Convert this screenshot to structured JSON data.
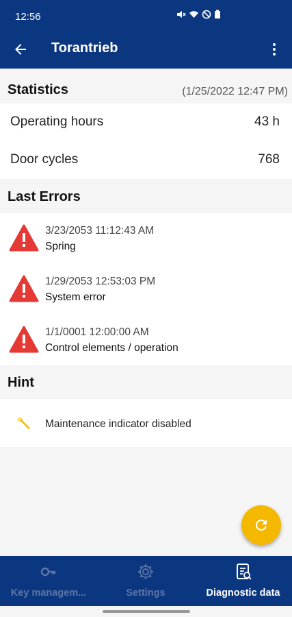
{
  "status_bar": {
    "time": "12:56"
  },
  "app_bar": {
    "title": "Torantrieb"
  },
  "statistics": {
    "title": "Statistics",
    "timestamp": "(1/25/2022 12:47 PM)",
    "rows": [
      {
        "label": "Operating hours",
        "value": "43 h"
      },
      {
        "label": "Door cycles",
        "value": "768"
      }
    ]
  },
  "last_errors": {
    "title": "Last Errors",
    "items": [
      {
        "date": "3/23/2053 11:12:43 AM",
        "description": "Spring"
      },
      {
        "date": "1/29/2053 12:53:03 PM",
        "description": "System error"
      },
      {
        "date": "1/1/0001 12:00:00 AM",
        "description": "Control elements / operation"
      }
    ]
  },
  "hint": {
    "title": "Hint",
    "text": "Maintenance indicator disabled"
  },
  "bottom_nav": {
    "items": [
      {
        "label": "Key managem...",
        "icon": "key-icon",
        "active": false
      },
      {
        "label": "Settings",
        "icon": "gear-icon",
        "active": false
      },
      {
        "label": "Diagnostic data",
        "icon": "diagnostic-icon",
        "active": true
      }
    ]
  },
  "colors": {
    "primary": "#0b3680",
    "error": "#e53935",
    "accent": "#f5b800",
    "nav_inactive": "#5c76a8"
  }
}
